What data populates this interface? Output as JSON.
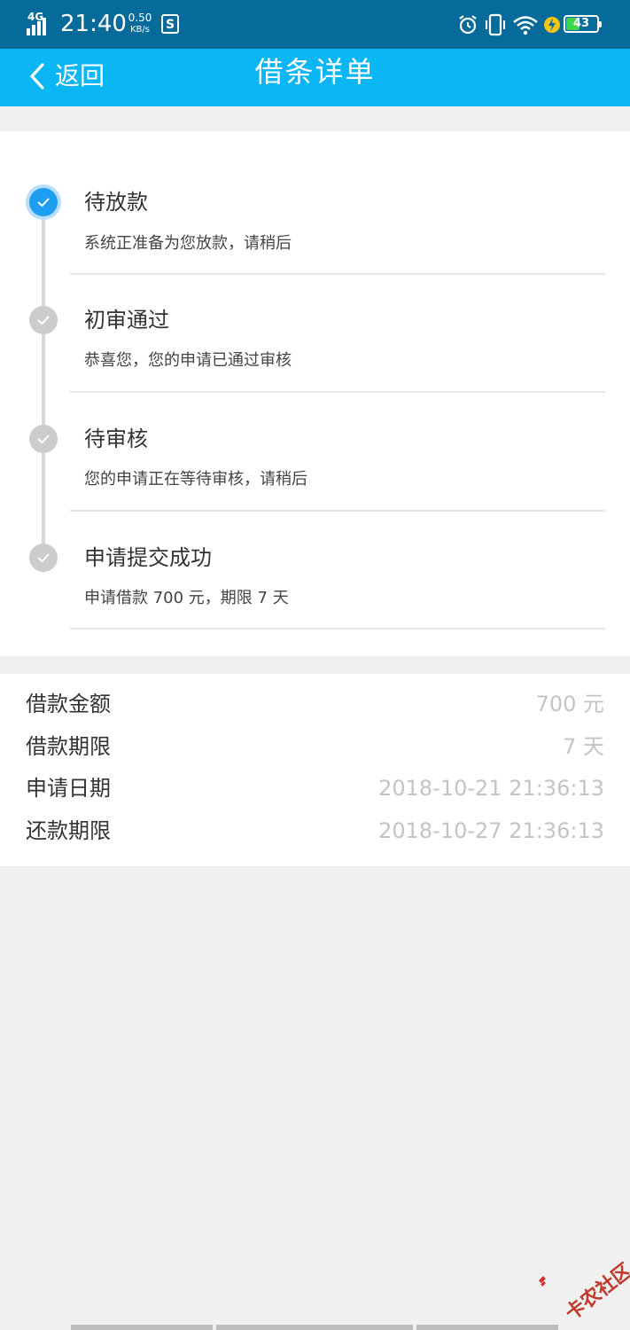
{
  "status_bar": {
    "network": "4G",
    "time": "21:40",
    "speed_value": "0.50",
    "speed_unit": "KB/s",
    "battery": "43",
    "icons": [
      "signal-icon",
      "s-app-icon",
      "alarm-icon",
      "vibrate-icon",
      "wifi-icon",
      "charging-icon",
      "battery-icon"
    ]
  },
  "nav": {
    "back_label": "返回",
    "title": "借条详单"
  },
  "timeline": {
    "steps": [
      {
        "title": "待放款",
        "desc": "系统正准备为您放款，请稍后",
        "state": "active"
      },
      {
        "title": "初审通过",
        "desc": "恭喜您，您的申请已通过审核",
        "state": "done"
      },
      {
        "title": "待审核",
        "desc": "您的申请正在等待审核，请稍后",
        "state": "done"
      },
      {
        "title": "申请提交成功",
        "desc": "申请借款 700 元，期限 7 天",
        "state": "done"
      }
    ]
  },
  "details": {
    "rows": [
      {
        "label": "借款金额",
        "value": "700 元"
      },
      {
        "label": "借款期限",
        "value": "7 天"
      },
      {
        "label": "申请日期",
        "value": "2018-10-21 21:36:13"
      },
      {
        "label": "还款期限",
        "value": "2018-10-27 21:36:13"
      }
    ]
  },
  "watermark": {
    "text": "卡农社区"
  },
  "colors": {
    "status_bar": "#066b9a",
    "nav_bar": "#0bb6f5",
    "active_dot": "#1e9ef1",
    "done_dot": "#cccccc"
  }
}
